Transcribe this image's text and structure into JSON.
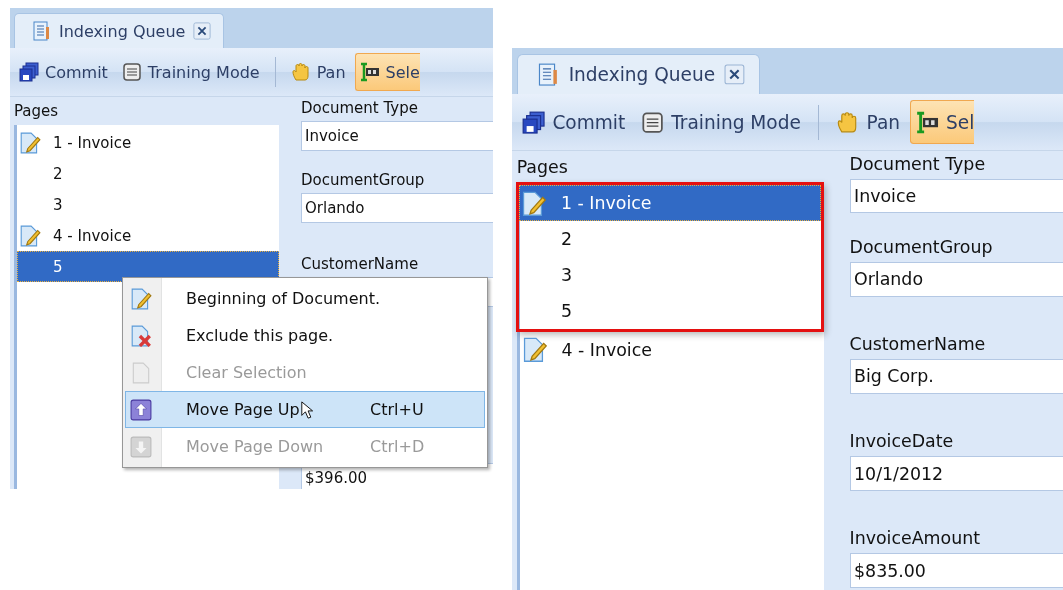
{
  "panels": [
    {
      "tab": {
        "title": "Indexing Queue"
      },
      "toolbar": [
        {
          "label": "Commit",
          "kind": "commit",
          "selected": false,
          "separator": false
        },
        {
          "label": "Training Mode",
          "kind": "training",
          "selected": false,
          "separator": false
        },
        {
          "label": "Pan",
          "kind": "pan",
          "selected": false,
          "separator": true
        },
        {
          "label": "Sele",
          "kind": "select",
          "selected": true,
          "separator": false
        }
      ],
      "pages_label": "Pages",
      "page_groups": [
        {
          "highlighted": false,
          "items": [
            {
              "label": "1 - Invoice",
              "kind": "document",
              "selected": false
            },
            {
              "label": "2",
              "kind": "page",
              "selected": false
            },
            {
              "label": "3",
              "kind": "page",
              "selected": false
            },
            {
              "label": "4 - Invoice",
              "kind": "document",
              "selected": false
            },
            {
              "label": "5",
              "kind": "page",
              "selected": true
            }
          ]
        }
      ],
      "fields": [
        {
          "label": "Document Type",
          "value": "Invoice"
        },
        {
          "label": "DocumentGroup",
          "value": "Orlando"
        },
        {
          "label": "CustomerName"
        },
        {
          "value": "$396.00"
        }
      ],
      "context_menu": {
        "items": [
          {
            "label": "Beginning of Document.",
            "kind": "doc-edit",
            "disabled": false,
            "selected": false
          },
          {
            "label": "Exclude this page.",
            "kind": "doc-exclude",
            "disabled": false,
            "selected": false
          },
          {
            "label": "Clear Selection",
            "kind": "page",
            "disabled": true,
            "selected": false
          },
          {
            "label": "Move Page Up",
            "shortcut": "Ctrl+U",
            "kind": "up",
            "disabled": false,
            "selected": true
          },
          {
            "label": "Move Page Down",
            "shortcut": "Ctrl+D",
            "kind": "down",
            "disabled": true,
            "selected": false
          }
        ]
      }
    },
    {
      "tab": {
        "title": "Indexing Queue"
      },
      "toolbar": [
        {
          "label": "Commit",
          "kind": "commit",
          "selected": false,
          "separator": false
        },
        {
          "label": "Training Mode",
          "kind": "training",
          "selected": false,
          "separator": false
        },
        {
          "label": "Pan",
          "kind": "pan",
          "selected": false,
          "separator": true
        },
        {
          "label": "Sel",
          "kind": "select",
          "selected": true,
          "separator": false
        }
      ],
      "pages_label": "Pages",
      "page_groups": [
        {
          "highlighted": true,
          "items": [
            {
              "label": "1 - Invoice",
              "kind": "document",
              "selected": true
            },
            {
              "label": "2",
              "kind": "page",
              "selected": false
            },
            {
              "label": "3",
              "kind": "page",
              "selected": false
            },
            {
              "label": "5",
              "kind": "page",
              "selected": false
            }
          ]
        },
        {
          "highlighted": false,
          "items": [
            {
              "label": "4 - Invoice",
              "kind": "document",
              "selected": false
            }
          ]
        }
      ],
      "fields": [
        {
          "label": "Document Type",
          "value": "Invoice"
        },
        {
          "label": "DocumentGroup",
          "value": "Orlando"
        },
        {
          "label": "CustomerName",
          "value": "Big Corp."
        },
        {
          "label": "InvoiceDate",
          "value": "10/1/2012"
        },
        {
          "label": "InvoiceAmount",
          "value": "$835.00"
        }
      ]
    }
  ]
}
